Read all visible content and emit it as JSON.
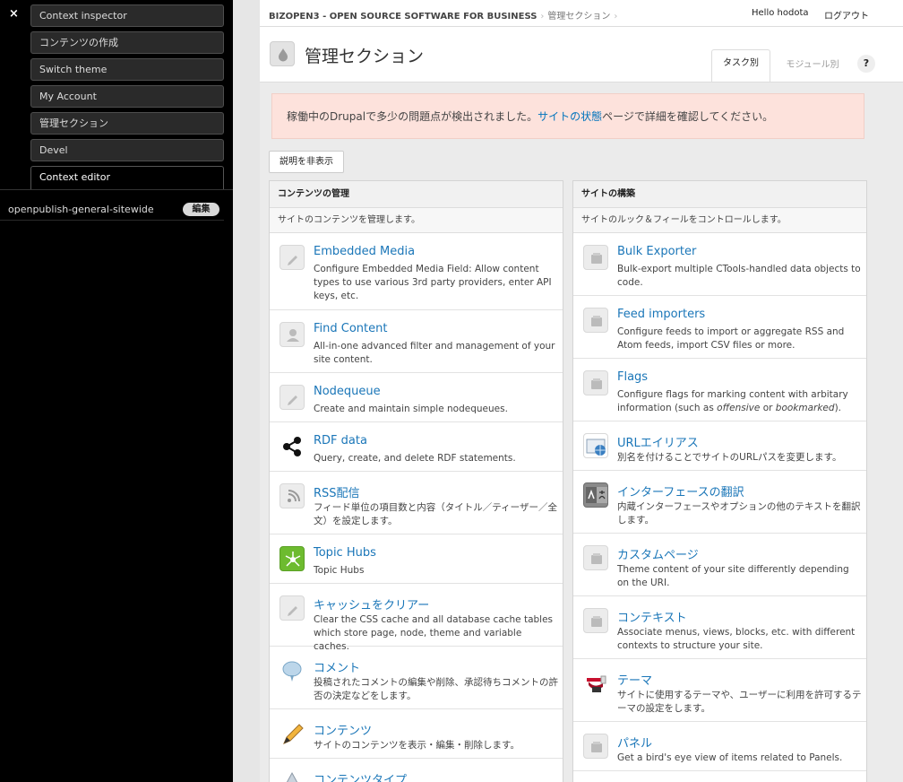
{
  "sidebar": {
    "close_label": "×",
    "items": [
      {
        "label": "Context inspector"
      },
      {
        "label": "コンテンツの作成"
      },
      {
        "label": "Switch theme"
      },
      {
        "label": "My Account"
      },
      {
        "label": "管理セクション"
      },
      {
        "label": "Devel"
      },
      {
        "label": "Context editor"
      }
    ],
    "context_row": {
      "name": "openpublish-general-sitewide",
      "edit_label": "編集"
    }
  },
  "topbar": {
    "breadcrumb": [
      "BIZOPEN3 - OPEN SOURCE SOFTWARE FOR BUSINESS",
      "管理セクション"
    ],
    "breadcrumb_sep": "›",
    "hello": "Hello hodota",
    "logout": "ログアウト"
  },
  "page": {
    "title": "管理セクション",
    "tabs": [
      "タスク別",
      "モジュール別"
    ],
    "help": "?",
    "alert": {
      "before": "稼働中のDrupalで多少の問題点が検出されました。",
      "link": "サイトの状態",
      "after": "ページで詳細を確認してください。"
    },
    "toggle_desc": "説明を非表示"
  },
  "panels": {
    "left": {
      "heading": "コンテンツの管理",
      "description": "サイトのコンテンツを管理します。",
      "items": [
        {
          "title": "Embedded Media",
          "desc": "Configure Embedded Media Field: Allow content types to use various 3rd party providers, enter API keys, etc.",
          "icon": "pencil-icon"
        },
        {
          "title": "Find Content",
          "desc": "All-in-one advanced filter and management of your site content.",
          "icon": "person-icon"
        },
        {
          "title": "Nodequeue",
          "desc": "Create and maintain simple nodequeues.",
          "icon": "pencil-icon"
        },
        {
          "title": "RDF data",
          "desc": "Query, create, and delete RDF statements.",
          "icon": "share-icon"
        },
        {
          "title": "RSS配信",
          "desc": "フィード単位の項目数と内容（タイトル／ティーザー／全文）を設定します。",
          "icon": "rss-icon"
        },
        {
          "title": "Topic Hubs",
          "desc": "Topic Hubs",
          "icon": "hub-icon"
        },
        {
          "title": "キャッシュをクリアー",
          "desc": "Clear the CSS cache and all database cache tables which store page, node, theme and variable caches.",
          "icon": "pencil-icon"
        },
        {
          "title": "コメント",
          "desc": "投稿されたコメントの編集や削除、承認待ちコメントの許否の決定などをします。",
          "icon": "comment-icon"
        },
        {
          "title": "コンテンツ",
          "desc": "サイトのコンテンツを表示・編集・削除します。",
          "icon": "pencil-color-icon"
        },
        {
          "title": "コンテンツタイプ",
          "desc": "",
          "icon": "triangle-icon"
        }
      ]
    },
    "right": {
      "heading": "サイトの構築",
      "description": "サイトのルック＆フィールをコントロールします。",
      "items": [
        {
          "title": "Bulk Exporter",
          "desc": "Bulk-export multiple CTools-handled data objects to code.",
          "icon": "box-icon"
        },
        {
          "title": "Feed importers",
          "desc": "Configure feeds to import or aggregate RSS and Atom feeds, import CSV files or more.",
          "icon": "box-icon"
        },
        {
          "title": "Flags",
          "desc_before": "Configure flags for marking content with arbitary information (such as ",
          "desc_em1": "offensive",
          "desc_mid": " or ",
          "desc_em2": "bookmarked",
          "desc_after": ").",
          "icon": "box-icon"
        },
        {
          "title": "URLエイリアス",
          "desc": "別名を付けることでサイトのURLパスを変更します。",
          "icon": "url-alias-icon"
        },
        {
          "title": "インターフェースの翻訳",
          "desc": "内蔵インターフェースやオプションの他のテキストを翻訳します。",
          "icon": "translate-icon"
        },
        {
          "title": "カスタムページ",
          "desc": "Theme content of your site differently depending on the URI.",
          "icon": "box-icon"
        },
        {
          "title": "コンテキスト",
          "desc": "Associate menus, views, blocks, etc. with different contexts to structure your site.",
          "icon": "box-icon"
        },
        {
          "title": "テーマ",
          "desc": "サイトに使用するテーマや、ユーザーに利用を許可するテーマの設定をします。",
          "icon": "theme-icon"
        },
        {
          "title": "パネル",
          "desc": "Get a bird's eye view of items related to Panels.",
          "icon": "box-icon"
        }
      ]
    }
  }
}
